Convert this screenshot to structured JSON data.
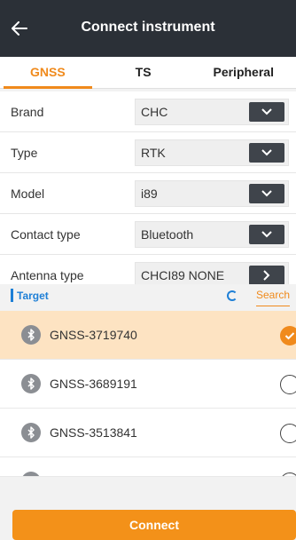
{
  "header": {
    "title": "Connect instrument"
  },
  "tabs": [
    {
      "label": "GNSS",
      "active": true
    },
    {
      "label": "TS",
      "active": false
    },
    {
      "label": "Peripheral",
      "active": false
    }
  ],
  "form": {
    "rows": [
      {
        "label": "Brand",
        "value": "CHC",
        "control": "dropdown"
      },
      {
        "label": "Type",
        "value": "RTK",
        "control": "dropdown"
      },
      {
        "label": "Model",
        "value": "i89",
        "control": "dropdown"
      },
      {
        "label": "Contact type",
        "value": "Bluetooth",
        "control": "dropdown"
      },
      {
        "label": "Antenna type",
        "value": "CHCI89 NONE",
        "control": "next"
      }
    ]
  },
  "target": {
    "label": "Target",
    "search_label": "Search"
  },
  "devices": [
    {
      "name": "GNSS-3719740",
      "selected": true
    },
    {
      "name": "GNSS-3689191",
      "selected": false
    },
    {
      "name": "GNSS-3513841",
      "selected": false
    }
  ],
  "footer": {
    "connect_label": "Connect"
  },
  "colors": {
    "accent": "#f08a1c",
    "appbar": "#2b3037",
    "link": "#1e7fd6",
    "selected_row": "#fde3c2"
  }
}
